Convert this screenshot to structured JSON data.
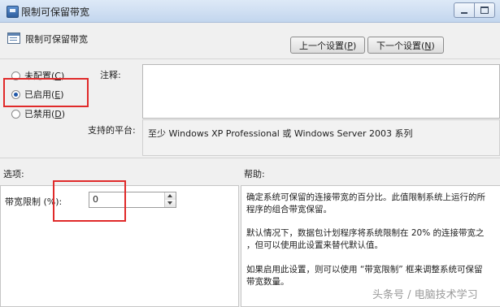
{
  "window": {
    "title": "限制可保留带宽"
  },
  "header": {
    "setting_name": "限制可保留带宽",
    "prev_label_pre": "上一个设置(",
    "prev_key": "P",
    "prev_label_post": ")",
    "next_label_pre": "下一个设置(",
    "next_key": "N",
    "next_label_post": ")"
  },
  "state": {
    "options": [
      {
        "pre": "未配置(",
        "key": "C",
        "post": ")",
        "selected": false
      },
      {
        "pre": "已启用(",
        "key": "E",
        "post": ")",
        "selected": true
      },
      {
        "pre": "已禁用(",
        "key": "D",
        "post": ")",
        "selected": false
      }
    ]
  },
  "comment": {
    "label": "注释:",
    "value": ""
  },
  "platform": {
    "label": "支持的平台:",
    "value": "至少 Windows XP Professional 或 Windows Server 2003 系列"
  },
  "sections": {
    "options_label": "选项:",
    "help_label": "帮助:"
  },
  "options_panel": {
    "bandwidth_label": "带宽限制 (%):",
    "bandwidth_value": "0"
  },
  "help": {
    "paragraphs": [
      "确定系统可保留的连接带宽的百分比。此值限制系统上运行的所\n程序的组合带宽保留。",
      "默认情况下，数据包计划程序将系统限制在 20% 的连接带宽之\n，但可以使用此设置来替代默认值。",
      "如果启用此设置，则可以使用 “带宽限制” 框来调整系统可保留\n带宽数量。"
    ]
  },
  "watermark": "头条号 / 电脑技术学习",
  "colors": {
    "highlight": "#e02a2a",
    "titlebar": "#c3d6ee"
  }
}
